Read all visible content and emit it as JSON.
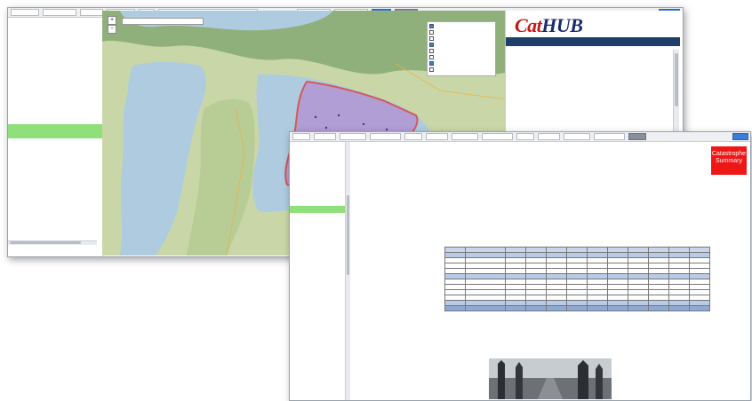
{
  "back_window": {
    "toolbar": {
      "buttons": [
        "",
        "",
        "",
        "",
        "",
        "",
        "",
        "",
        ""
      ],
      "search_placeholder": ""
    },
    "sidebar": {
      "items": [
        {
          "label": "",
          "style": "normal"
        },
        {
          "label": "",
          "style": "normal"
        },
        {
          "label": "",
          "style": "sub"
        },
        {
          "label": "",
          "style": "sub"
        },
        {
          "label": "",
          "style": "sub"
        },
        {
          "label": "",
          "style": "sub"
        },
        {
          "label": "",
          "style": "sub"
        },
        {
          "label": "",
          "style": "sub"
        },
        {
          "label": "",
          "style": "sub"
        },
        {
          "label": "",
          "style": "sub"
        },
        {
          "label": "",
          "style": "sub"
        },
        {
          "label": "",
          "style": "sub"
        },
        {
          "label": "",
          "style": "sub"
        },
        {
          "label": "",
          "style": "sub"
        },
        {
          "label": "",
          "style": "sub"
        },
        {
          "label": "",
          "style": "hl"
        },
        {
          "label": "",
          "style": "hl"
        }
      ]
    },
    "map": {
      "zoom_in": "+",
      "zoom_out": "−",
      "legend_items": [
        "",
        "",
        "",
        "",
        "",
        "",
        "",
        ""
      ]
    },
    "logo": {
      "part1": "Cat",
      "part2": "HUB"
    },
    "info_lines": [
      "",
      "",
      "",
      "",
      "",
      "",
      "",
      "",
      "",
      "",
      "",
      ""
    ]
  },
  "front_window": {
    "toolbar": {
      "buttons": [
        "",
        "",
        "",
        "",
        "",
        "",
        "",
        "",
        "",
        "",
        "",
        "",
        ""
      ]
    },
    "sidebar": {
      "items": [
        {
          "label": "",
          "style": "normal"
        },
        {
          "label": "",
          "style": "sub"
        },
        {
          "label": "",
          "style": "sub"
        },
        {
          "label": "",
          "style": "normal"
        },
        {
          "label": "",
          "style": "sub"
        },
        {
          "label": "",
          "style": "sub"
        },
        {
          "label": "",
          "style": "normal"
        },
        {
          "label": "",
          "style": "sub"
        },
        {
          "label": "",
          "style": "sub"
        },
        {
          "label": "",
          "style": "hl"
        },
        {
          "label": "",
          "style": "normal"
        },
        {
          "label": "",
          "style": "sub"
        },
        {
          "label": "",
          "style": "sub"
        },
        {
          "label": "",
          "style": "normal"
        },
        {
          "label": "",
          "style": "sub"
        },
        {
          "label": "",
          "style": "sub"
        },
        {
          "label": "",
          "style": "normal"
        },
        {
          "label": "",
          "style": "sub"
        },
        {
          "label": "",
          "style": "sub"
        },
        {
          "label": "",
          "style": "normal"
        },
        {
          "label": "",
          "style": "sub"
        },
        {
          "label": "",
          "style": "sub"
        },
        {
          "label": "",
          "style": "normal"
        },
        {
          "label": "",
          "style": "sub"
        },
        {
          "label": "",
          "style": "sub"
        },
        {
          "label": "",
          "style": "normal"
        },
        {
          "label": "",
          "style": "sub"
        },
        {
          "label": "",
          "style": "sub"
        },
        {
          "label": "",
          "style": "normal"
        },
        {
          "label": "",
          "style": "sub"
        },
        {
          "label": "",
          "style": "sub"
        },
        {
          "label": "",
          "style": "normal"
        },
        {
          "label": "",
          "style": "sub"
        },
        {
          "label": "",
          "style": "sub"
        },
        {
          "label": "",
          "style": "normal"
        },
        {
          "label": "",
          "style": "sub"
        }
      ]
    },
    "doc_title": "",
    "badge_text": "Catastrophe Summary",
    "link_list": [
      "",
      "",
      "",
      "",
      "",
      "",
      "",
      ""
    ],
    "heading_summary": "",
    "summary_para": "",
    "table_title": "",
    "heading_description": "",
    "description_para": "",
    "table": {
      "headers": [
        "",
        "",
        "",
        "",
        "",
        "",
        "",
        "",
        "",
        "",
        "",
        ""
      ],
      "rows": [
        {
          "type": "grp",
          "cells": [
            "",
            "",
            "",
            "",
            "",
            "",
            "",
            "",
            "",
            "",
            "",
            ""
          ]
        },
        {
          "type": "row",
          "cells": [
            "",
            "",
            "",
            "",
            "",
            "",
            "",
            "",
            "",
            "",
            "",
            ""
          ]
        },
        {
          "type": "row",
          "cells": [
            "",
            "",
            "",
            "",
            "",
            "",
            "",
            "",
            "",
            "",
            "",
            ""
          ]
        },
        {
          "type": "row",
          "cells": [
            "",
            "",
            "",
            "",
            "",
            "",
            "",
            "",
            "",
            "",
            "",
            ""
          ]
        },
        {
          "type": "grp",
          "cells": [
            "",
            "",
            "",
            "",
            "",
            "",
            "",
            "",
            "",
            "",
            "",
            ""
          ]
        },
        {
          "type": "row",
          "cells": [
            "",
            "",
            "",
            "",
            "",
            "",
            "",
            "",
            "",
            "",
            "",
            ""
          ]
        },
        {
          "type": "row",
          "cells": [
            "",
            "",
            "",
            "",
            "",
            "",
            "",
            "",
            "",
            "",
            "",
            ""
          ]
        },
        {
          "type": "row",
          "cells": [
            "",
            "",
            "",
            "",
            "",
            "",
            "",
            "",
            "",
            "",
            "",
            ""
          ]
        },
        {
          "type": "row",
          "cells": [
            "",
            "",
            "",
            "",
            "",
            "",
            "",
            "",
            "",
            "",
            "",
            ""
          ]
        },
        {
          "type": "grp",
          "cells": [
            "",
            "",
            "",
            "",
            "",
            "",
            "",
            "",
            "",
            "",
            "",
            ""
          ]
        },
        {
          "type": "tot",
          "cells": [
            "",
            "",
            "",
            "",
            "",
            "",
            "",
            "",
            "",
            "",
            "",
            ""
          ]
        }
      ]
    }
  },
  "colors": {
    "map_water": "#aecbe0",
    "map_land": "#c9d7a8",
    "map_forest": "#8fb07a",
    "highlight_purple": "#b38fd1",
    "boundary_red": "#e0332f",
    "sidebar_highlight": "#8fe07a",
    "badge_red": "#ef1616",
    "logo_navy": "#1a2b6d",
    "logo_red": "#c31818"
  }
}
